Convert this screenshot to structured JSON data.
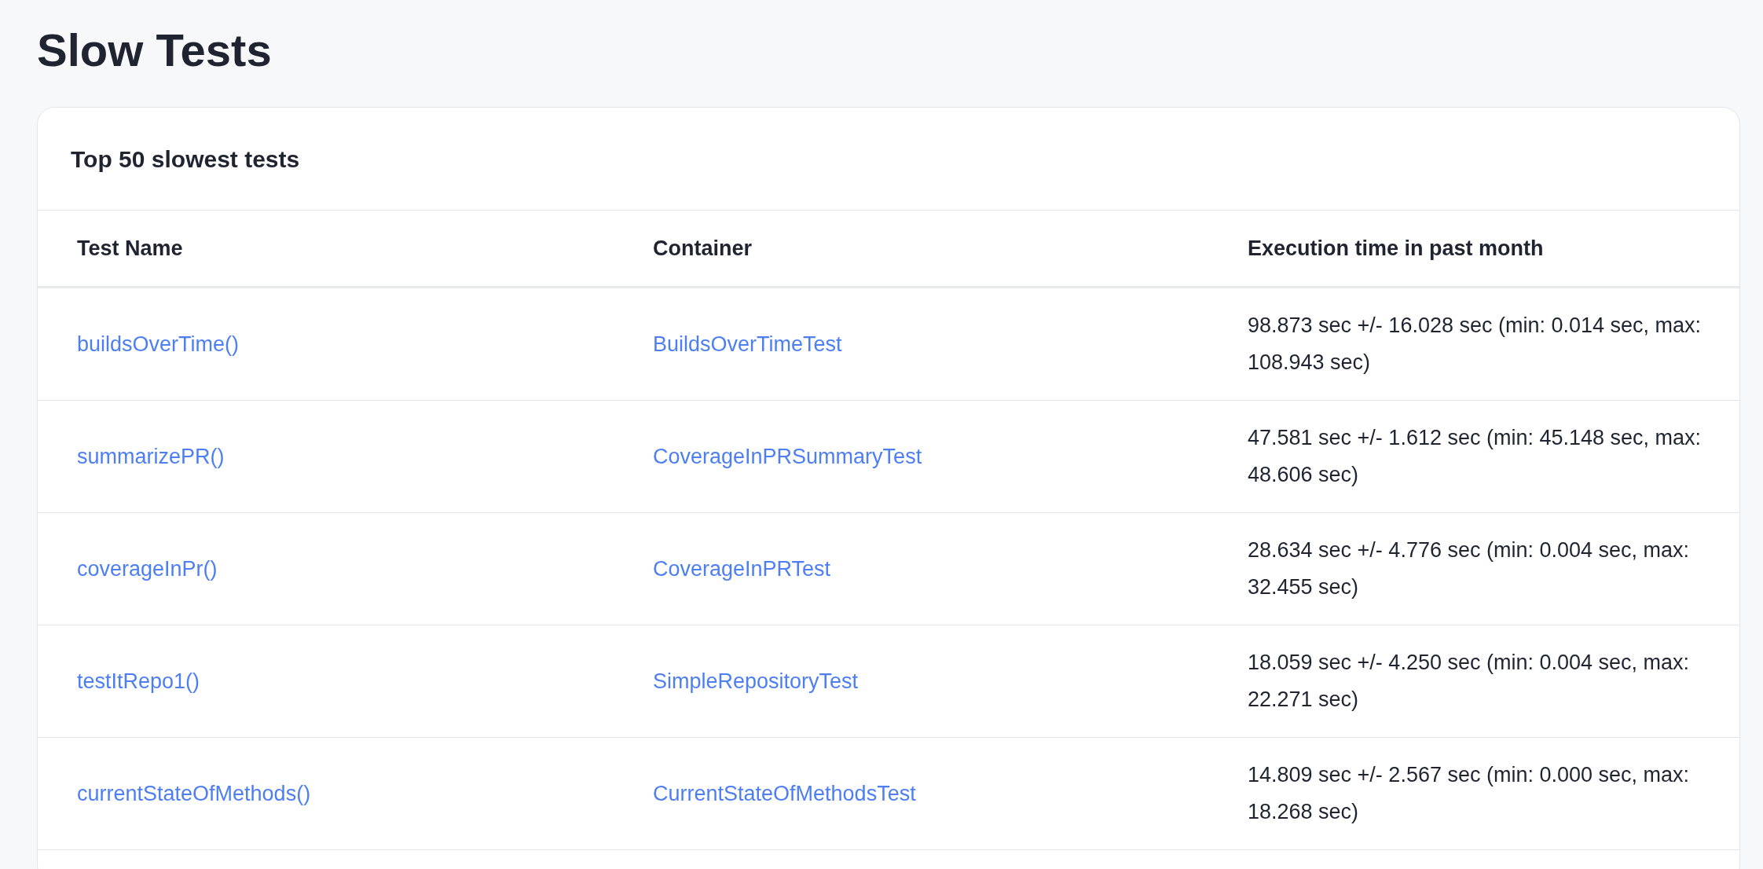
{
  "page": {
    "title": "Slow Tests"
  },
  "card": {
    "title": "Top 50 slowest tests"
  },
  "table": {
    "columns": [
      "Test Name",
      "Container",
      "Execution time in past month"
    ],
    "rows": [
      {
        "test_name": "buildsOverTime()",
        "container": "BuildsOverTimeTest",
        "execution_time": "98.873 sec +/- 16.028 sec (min: 0.014 sec, max: 108.943 sec)"
      },
      {
        "test_name": "summarizePR()",
        "container": "CoverageInPRSummaryTest",
        "execution_time": "47.581 sec +/- 1.612 sec (min: 45.148 sec, max: 48.606 sec)"
      },
      {
        "test_name": "coverageInPr()",
        "container": "CoverageInPRTest",
        "execution_time": "28.634 sec +/- 4.776 sec (min: 0.004 sec, max: 32.455 sec)"
      },
      {
        "test_name": "testItRepo1()",
        "container": "SimpleRepositoryTest",
        "execution_time": "18.059 sec +/- 4.250 sec (min: 0.004 sec, max: 22.271 sec)"
      },
      {
        "test_name": "currentStateOfMethods()",
        "container": "CurrentStateOfMethodsTest",
        "execution_time": "14.809 sec +/- 2.567 sec (min: 0.000 sec, max: 18.268 sec)"
      }
    ]
  }
}
